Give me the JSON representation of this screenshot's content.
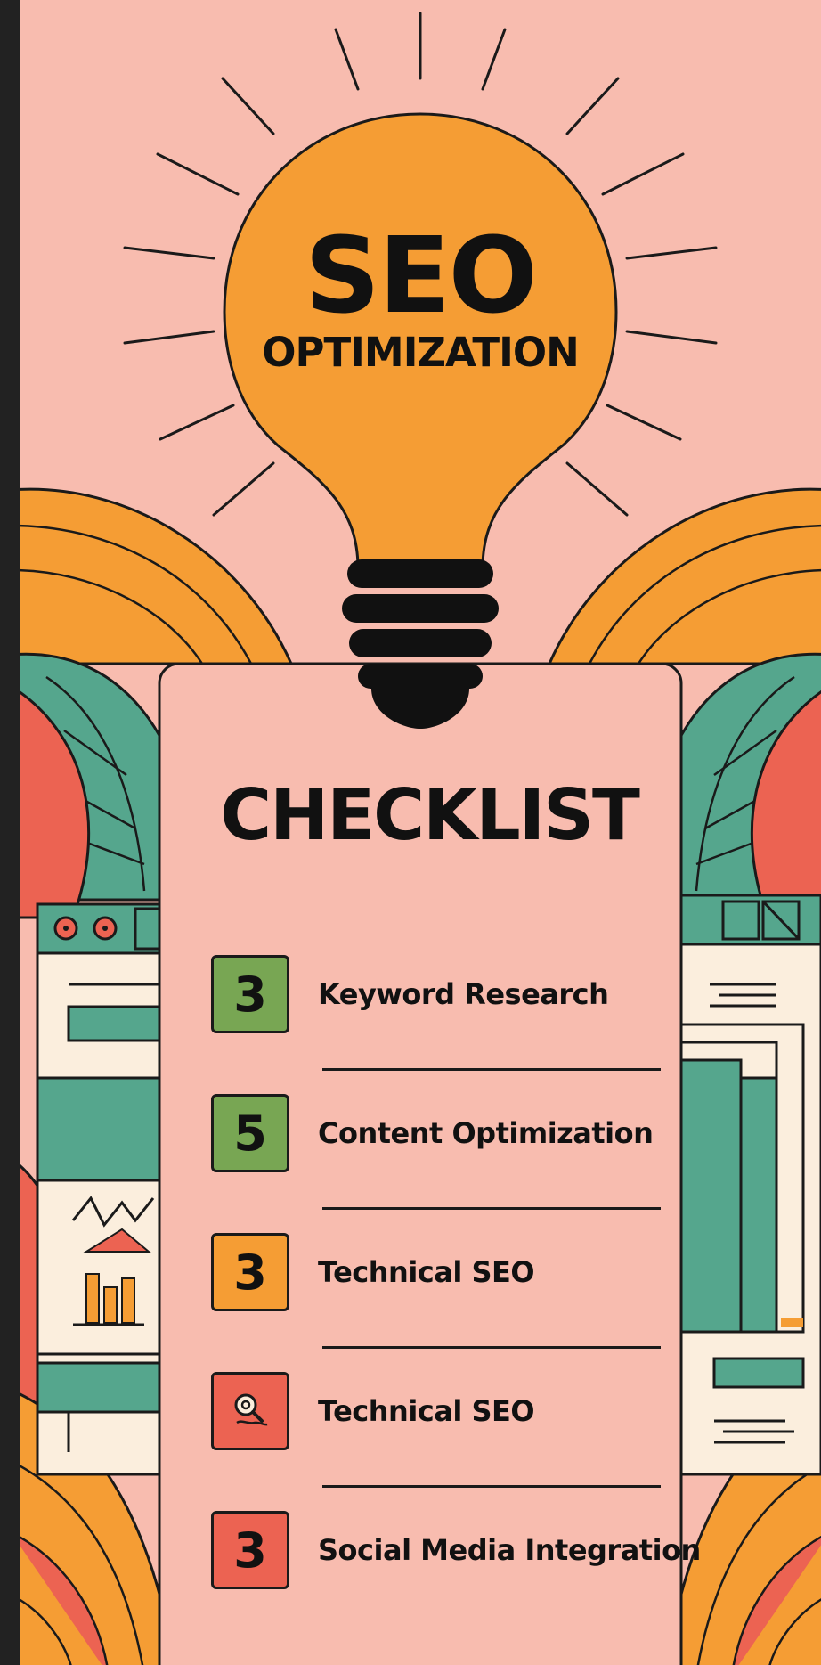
{
  "header": {
    "title": "SEO",
    "subtitle": "OPTIMIZATION"
  },
  "card": {
    "title": "CHECKLIST"
  },
  "checklist": [
    {
      "badge": "3",
      "label": "Keyword Research",
      "color": "#78a653"
    },
    {
      "badge": "5",
      "label": "Content Optimization",
      "color": "#78a653"
    },
    {
      "badge": "3",
      "label": "Technical SEO",
      "color": "#f59d34"
    },
    {
      "badge": "",
      "badge_icon": "search-gear-icon",
      "label": "Technical SEO",
      "color": "#ec6352"
    },
    {
      "badge": "3",
      "label": "Social Media Integration",
      "color": "#ec6352"
    }
  ],
  "colors": {
    "background": "#f8bcaf",
    "bulb": "#f59d34",
    "teal": "#55a68d",
    "coral": "#ec6352",
    "cream": "#fbeedd",
    "outline": "#1a1a1a"
  }
}
